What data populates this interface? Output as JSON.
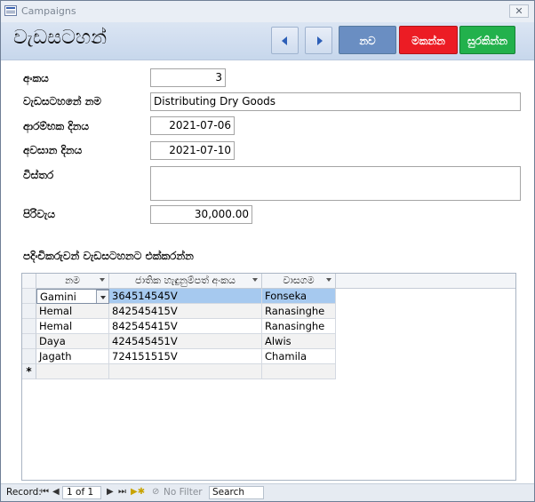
{
  "window": {
    "title": "Campaigns",
    "close_label": "✕"
  },
  "header": {
    "form_title": "වැඩසටහන්",
    "buttons": {
      "new": "නව",
      "delete": "මකන්න",
      "save": "සුරකින්න"
    }
  },
  "fields": {
    "number": {
      "label": "අංකය",
      "value": "3"
    },
    "name": {
      "label": "වැඩසටහනේ නම",
      "value": "Distributing Dry Goods"
    },
    "start_date": {
      "label": "ආරම්භක දිනය",
      "value": "2021-07-06"
    },
    "end_date": {
      "label": "අවසාන දිනය",
      "value": "2021-07-10"
    },
    "details": {
      "label": "විස්තර",
      "value": ""
    },
    "cost": {
      "label": "පිරිවැය",
      "value": "30,000.00"
    }
  },
  "subform": {
    "title": "පදිංචිකරුවන් වැඩසටහනට එක්කරන්න",
    "columns": [
      "නම",
      "ජාතික හැඳුනුම්පත් අංකය",
      "වාසගම"
    ],
    "rows": [
      {
        "name": "Gamini",
        "nic": "364514545V",
        "surname": "Fonseka"
      },
      {
        "name": "Hemal",
        "nic": "842545415V",
        "surname": "Ranasinghe"
      },
      {
        "name": "Hemal",
        "nic": "842545415V",
        "surname": "Ranasinghe"
      },
      {
        "name": "Daya",
        "nic": "424545451V",
        "surname": "Alwis"
      },
      {
        "name": "Jagath",
        "nic": "724151515V",
        "surname": "Chamila"
      }
    ],
    "new_row_marker": "*"
  },
  "statusbar": {
    "record_label": "Record:",
    "position": "1 of 1",
    "filter_label": "No Filter",
    "search_label": "Search"
  }
}
